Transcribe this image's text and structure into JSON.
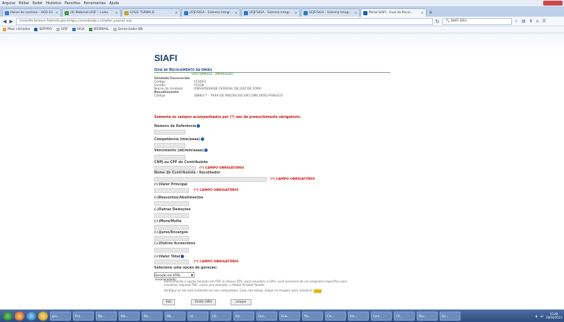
{
  "browser": {
    "menu": [
      "Arquivo",
      "Editar",
      "Exibir",
      "Histórico",
      "Favoritos",
      "Ferramentas",
      "Ajuda"
    ],
    "tabs": [
      {
        "label": "Painel de controle - HOD 10",
        "color": "#3a7bd5"
      },
      {
        "label": "(9) Webmail UFJF :: Lidas",
        "color": "#4a8f4a"
      },
      {
        "label": "LOGS: TURMA B",
        "color": "#c9a227"
      },
      {
        "label": "UFJF/SIGA - Sistema Integr...",
        "color": "#2b78c2"
      },
      {
        "label": "UFJF/SIGA - Sistema Integr...",
        "color": "#2b78c2"
      },
      {
        "label": "UFJF/SIGA - Sistema Integr...",
        "color": "#2b78c2"
      },
      {
        "label": "Portal SIAFI - Guia de Recol...",
        "color": "#1a5fb4",
        "active": true
      }
    ],
    "new_tab": "+",
    "url": "consulta.tesouro.fazenda.gov.br/gru_novosite/gru_simples_passo2.asp",
    "search": "SIAFI GRU",
    "bookmarks": [
      {
        "label": "Mais visitados",
        "color": "#f0a030"
      },
      {
        "label": "SERPRO",
        "color": "#1f5fa8"
      },
      {
        "label": "UFJF",
        "color": "#bbbbbb"
      },
      {
        "label": "SIGA",
        "color": "#2b78c2"
      },
      {
        "label": "WEBMAIL",
        "color": "#4a8f4a"
      },
      {
        "label": "Gerenciador BB",
        "color": "#bbbbbb"
      }
    ]
  },
  "page": {
    "logo": "SIAFI",
    "title": "Guia de Recolhimento da União",
    "subtitle": "GRU SIMPLES - IMPRESSÃO",
    "info": [
      {
        "label": "Unidade Favorecida",
        "value": "",
        "bold": true
      },
      {
        "label": "Código",
        "value": "153061"
      },
      {
        "label": "Gestão",
        "value": "15228"
      },
      {
        "label": "Nome da Unidade",
        "value": "UNIVERSIDADE FEDERAL DE JUIZ DE FORA"
      },
      {
        "label": "Recolhimento",
        "value": "",
        "bold": true
      },
      {
        "label": "Código",
        "value": "28883-7 - TAXA DE INSCRICAO EM CONCURSO PUBLICO"
      }
    ],
    "required_note": "Somente os campos acompanhados por (*) são de preenchimento obrigatório.",
    "fields": {
      "ref": "Número de Referência",
      "comp": "Competência (mm/aaaa)",
      "venc": "Vencimento (dd/mm/aaaa)",
      "cnpj": "CNPJ ou CPF do Contribuinte",
      "nome": "Nome do Contribuinte / Recolhedor",
      "principal": "(=)Valor Principal",
      "descontos": "(-)Descontos/Abatimentos",
      "deducoes": "(-)Outras Deduções",
      "mora": "(+)Mora/Multa",
      "juros": "(+)Juros/Encargos",
      "acrescimos": "(+)Outros Acréscimos",
      "total": "(=)Valor Total"
    },
    "campo_obrigatorio": "(*) CAMPO OBRIGATÓRIO",
    "geracao_label": "Selecione uma opção de geração:",
    "geracao_value": "Geração em HTML (recomendado)",
    "note1": "Selecionando a opção Geração em PDF ou Baixar PDF, para visualizar a GRU, você precisará de um programa específico para",
    "note2": "visualizar arquivos PDF, como, por exemplo, o Adobe Acrobat Reader.",
    "note3": "Verifique se ele está instalado em seu computador. Caso não esteja, clique na imagem para instalá-lo.",
    "buttons": {
      "sair": "Sair",
      "emitir": "Emitir GRU",
      "limpar": "Limpar"
    }
  },
  "taskbar": {
    "tasks": [
      "gru...",
      "Poli...",
      "Wo...",
      "Wo...",
      "Wo...",
      "Wo...",
      "LO...",
      "LO...",
      "Em...",
      "Fazi...",
      "Dub...",
      "Pla...",
      "Cor...",
      "Em...",
      "Com...",
      "CR...",
      "Doc...",
      "Far..."
    ],
    "time": "15:48",
    "date": "28/04/2013"
  }
}
